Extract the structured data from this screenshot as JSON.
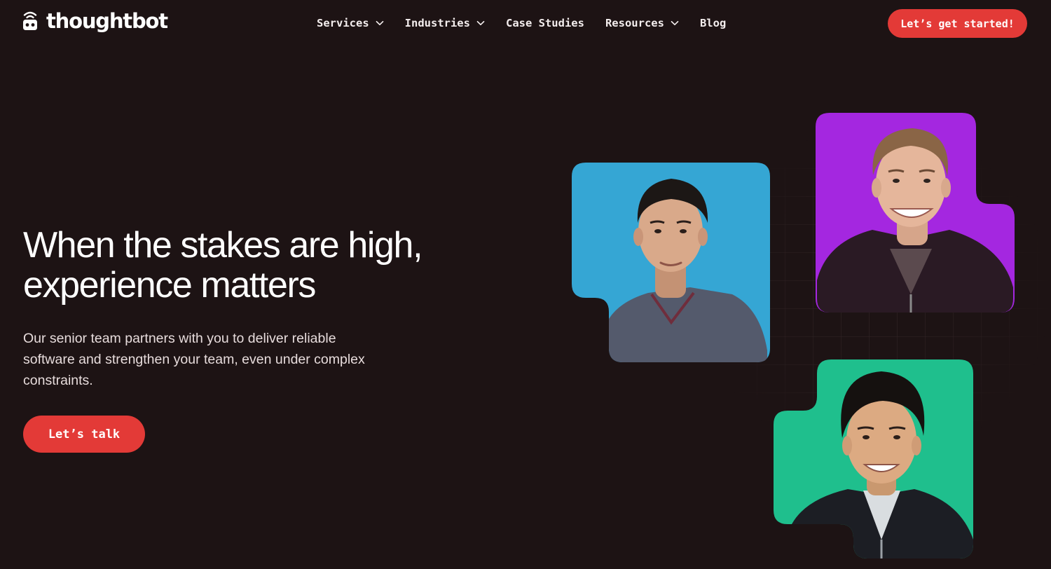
{
  "brand": {
    "name": "thoughtbot",
    "accent": "#e33a37",
    "background": "#1d1314"
  },
  "nav": {
    "items": [
      {
        "label": "Services",
        "icon": "chevron-down-icon"
      },
      {
        "label": "Industries",
        "icon": "chevron-down-icon"
      },
      {
        "label": "Case Studies"
      },
      {
        "label": "Resources",
        "icon": "chevron-down-icon"
      },
      {
        "label": "Blog"
      }
    ],
    "cta_label": "Let’s get started!"
  },
  "hero": {
    "title_line1": "When the stakes are high,",
    "title_line2": "experience matters",
    "subtitle": "Our senior team partners with you to deliver reliable software and strengthen your team, even under complex constraints.",
    "cta_label": "Let’s talk"
  },
  "portraits": [
    {
      "id": "blue",
      "background": "#35a6d4"
    },
    {
      "id": "purple",
      "background": "#a427e0"
    },
    {
      "id": "green",
      "background": "#1fbf8d"
    }
  ]
}
